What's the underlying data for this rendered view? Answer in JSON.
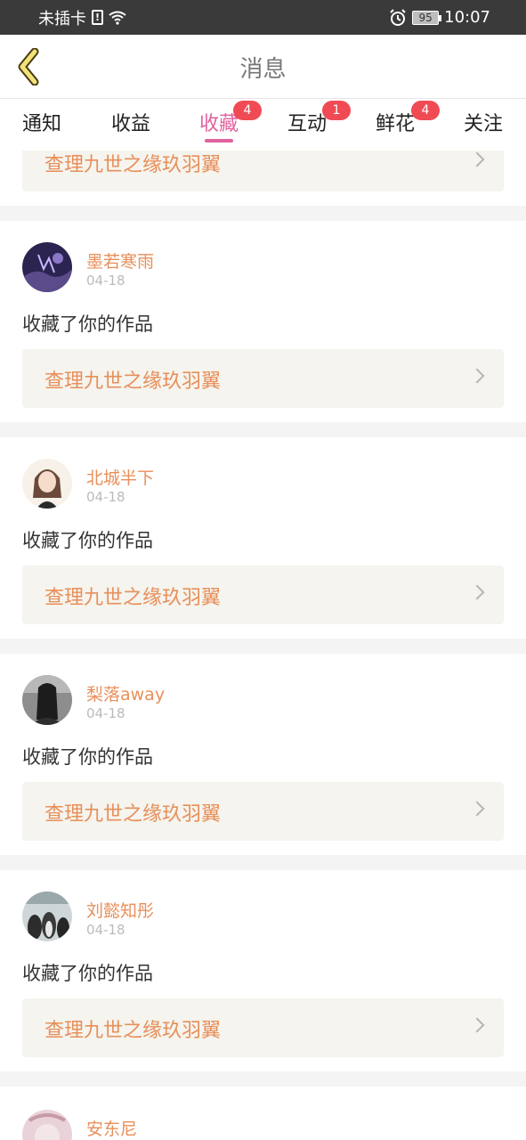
{
  "status_bar": {
    "carrier": "未插卡",
    "sim_alert": "!",
    "battery": "95",
    "time": "10:07"
  },
  "header": {
    "title": "消息"
  },
  "tabs": [
    {
      "label": "通知",
      "badge": ""
    },
    {
      "label": "收益",
      "badge": ""
    },
    {
      "label": "收藏",
      "badge": "4"
    },
    {
      "label": "互动",
      "badge": "1"
    },
    {
      "label": "鲜花",
      "badge": "4"
    },
    {
      "label": "关注",
      "badge": ""
    }
  ],
  "active_tab": "收藏",
  "colors": {
    "accent_pink": "#e0629f",
    "orange_text": "#e88f5a",
    "badge_red": "#f04b54"
  },
  "partial_top_card": {
    "work_title": "查理九世之缘玖羽翼"
  },
  "items": [
    {
      "username": "墨若寒雨",
      "date": "04-18",
      "action": "收藏了你的作品",
      "work_title": "查理九世之缘玖羽翼"
    },
    {
      "username": "北城半下",
      "date": "04-18",
      "action": "收藏了你的作品",
      "work_title": "查理九世之缘玖羽翼"
    },
    {
      "username": "梨落away",
      "date": "04-18",
      "action": "收藏了你的作品",
      "work_title": "查理九世之缘玖羽翼"
    },
    {
      "username": "刘懿知彤",
      "date": "04-18",
      "action": "收藏了你的作品",
      "work_title": "查理九世之缘玖羽翼"
    }
  ],
  "partial_bottom_card": {
    "username": "安东尼"
  }
}
